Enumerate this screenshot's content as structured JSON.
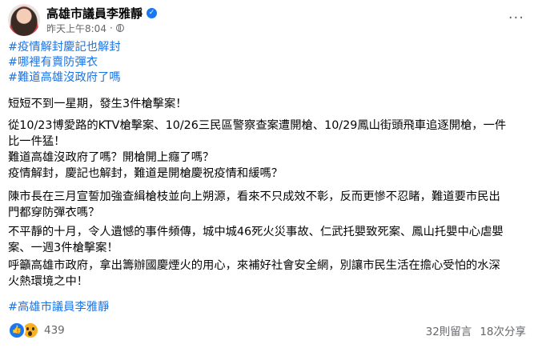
{
  "header": {
    "author": "高雄市議員李雅靜",
    "timestamp": "昨天上午8:04",
    "more": "···"
  },
  "post": {
    "hashtags": [
      "#疫情解封慶記也解封",
      "#哪裡有賣防彈衣",
      "#難道高雄沒政府了嗎"
    ],
    "paragraphs": [
      [
        "短短不到一星期，發生3件槍擊案！"
      ],
      [
        "從10/23博愛路的KTV槍擊案、10/26三民區警察查案遭開槍、10/29鳳山街頭飛車追逐開槍，一件",
        "比一件猛！"
      ],
      [
        "難道高雄沒政府了嗎？開槍開上癮了嗎？",
        "疫情解封，慶記也解封，難道是開槍慶祝疫情和緩嗎？"
      ],
      [
        "陳市長在三月宣誓加強查緝槍枝並向上朔源，看來不只成效不彰，反而更慘不忍睹，難道要市民出",
        "門都穿防彈衣嗎？"
      ],
      [
        "不平靜的十月，令人遺憾的事件頻傳，城中城46死火災事故、仁武托嬰致死案、鳳山托嬰中心虐嬰",
        "案、一週3件槍擊案！"
      ],
      [
        "呼籲高雄市政府，拿出籌辦國慶煙火的用心，來補好社會安全網，別讓市民生活在擔心受怕的水深",
        "火熱環境之中！"
      ]
    ],
    "closing_tag": "#高雄市議員李雅靜"
  },
  "footer": {
    "reaction_count": "439",
    "comments": "32則留言",
    "shares": "18次分享"
  },
  "colors": {
    "link": "#1b74e4",
    "meta": "#65676b",
    "verified": "#1877f2"
  }
}
